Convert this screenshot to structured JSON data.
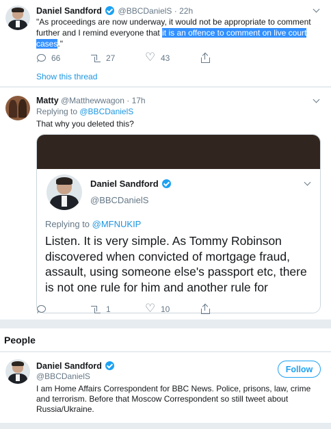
{
  "tweet1": {
    "name": "Daniel Sandford",
    "handle": "@BBCDanielS",
    "time": "· 22h",
    "text_before": "\"As proceedings are now underway, it would not be appropriate to comment further and I remind everyone that ",
    "text_highlight": "it is an offence to comment on live court cases",
    "text_after": ".\"",
    "replies": "66",
    "retweets": "27",
    "likes": "43",
    "show_thread": "Show this thread"
  },
  "tweet2": {
    "name": "Matty",
    "handle": "@Matthewwagon",
    "time": "· 17h",
    "replying_label": "Replying to ",
    "replying_handle": "@BBCDanielS",
    "text": "That why you deleted this?",
    "replies": "",
    "retweets": "1",
    "likes": "10"
  },
  "embedded": {
    "name": "Daniel Sandford",
    "handle": "@BBCDanielS",
    "replying_label": "Replying to ",
    "replying_handle": "@MFNUKIP",
    "text": "Listen. It is very simple. As Tommy Robinson discovered when convicted of mortgage fraud, assault, using someone else's passport etc, there is not one rule for him and another rule for"
  },
  "people": {
    "heading": "People",
    "name": "Daniel Sandford",
    "handle": "@BBCDanielS",
    "follow_label": "Follow",
    "bio": "I am Home Affairs Correspondent for BBC News. Police, prisons, law, crime and terrorism. Before that Moscow Correspondent so still tweet about Russia/Ukraine."
  },
  "colors": {
    "accent": "#1da1f2",
    "link": "#1b95e0",
    "highlight": "#3390ff",
    "muted": "#657786"
  },
  "icons": [
    "reply-icon",
    "retweet-icon",
    "like-icon",
    "share-icon",
    "verified-icon",
    "chevron-down-icon"
  ]
}
